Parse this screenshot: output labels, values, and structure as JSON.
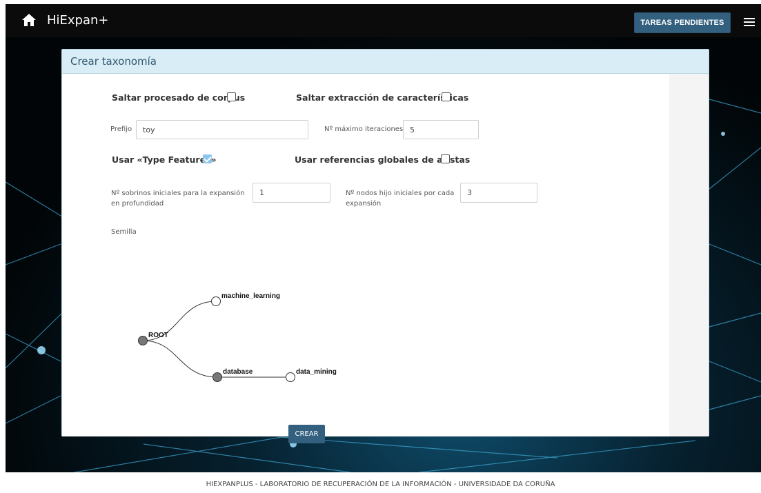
{
  "navbar": {
    "brand": "HiExpan+",
    "pending_button": "TAREAS PENDIENTES"
  },
  "card": {
    "title": "Crear taxonomía"
  },
  "form": {
    "skip_corpus_label": "Saltar procesado de corpus",
    "skip_corpus_checked": false,
    "skip_features_label": "Saltar extracción de características",
    "skip_features_checked": false,
    "prefix_label": "Prefijo",
    "prefix_value": "toy",
    "max_iterations_label": "Nº máximo iteraciones",
    "max_iterations_value": "5",
    "type_features_label": "Usar «Type Features»",
    "type_features_checked": true,
    "global_refs_label": "Usar referencias globales de aristas",
    "global_refs_checked": false,
    "siblings_label_line1": "Nº sobrinos iniciales para la expansión",
    "siblings_label_line2": "en profundidad",
    "siblings_value": "1",
    "children_label_line1": "Nº nodos hijo iniciales por cada",
    "children_label_line2": "expansión",
    "children_value": "3",
    "seed_label": "Semilla",
    "create_button": "CREAR"
  },
  "tree": {
    "nodes": {
      "root": "ROOT",
      "ml": "machine_learning",
      "db": "database",
      "dm": "data_mining"
    },
    "node_fill_collapsed": "#777777",
    "node_fill_leaf": "#ffffff"
  },
  "footer": {
    "text": "HIEXPANPLUS - LABORATORIO DE RECUPERACIÓN DE LA INFORMACIÓN - UNIVERSIDADE DA CORUÑA"
  },
  "colors": {
    "navbar_bg": "#0b0b0b",
    "button_bg": "#33607f",
    "header_bg": "#d9edf7",
    "checkbox_checked": "#8cc6ea"
  }
}
